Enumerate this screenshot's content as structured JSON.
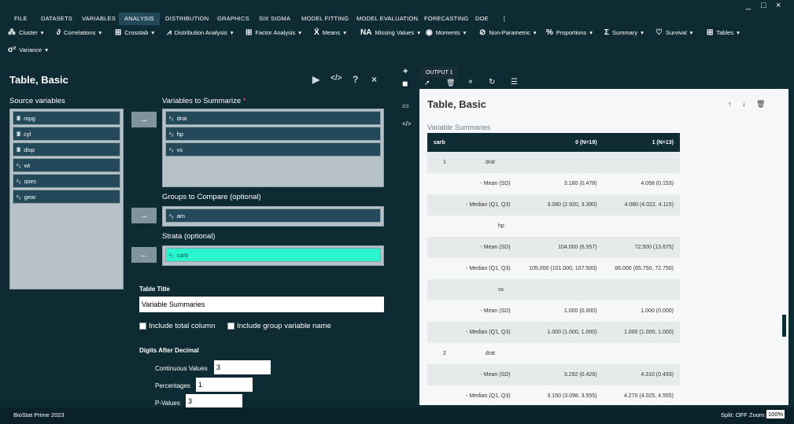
{
  "app": {
    "name": "BioStat Prime 2023"
  },
  "window_controls": [
    "_",
    "□",
    "×"
  ],
  "menu": [
    "FILE",
    "DATASETS",
    "VARIABLES",
    "ANALYSIS",
    "DISTRIBUTION",
    "GRAPHICS",
    "SIX SIGMA",
    "MODEL FITTING",
    "MODEL EVALUATION",
    "FORECASTING",
    "DOE",
    "⋮"
  ],
  "toolbar": [
    {
      "label": "Cluster",
      "icon": "cluster-icon"
    },
    {
      "label": "Correlations",
      "icon": "correlations-icon"
    },
    {
      "label": "Crosstab",
      "icon": "crosstab-icon"
    },
    {
      "label": "Distribution Analysis",
      "icon": "distribution-icon"
    },
    {
      "label": "Factor Analysis",
      "icon": "factor-icon"
    },
    {
      "label": "Means",
      "icon": "means-icon"
    },
    {
      "label": "Missing Values",
      "icon": "missing-icon"
    },
    {
      "label": "Moments",
      "icon": "moments-icon"
    },
    {
      "label": "Non-Parametric",
      "icon": "nonparametric-icon"
    },
    {
      "label": "Proportions",
      "icon": "proportions-icon"
    },
    {
      "label": "Summary",
      "icon": "summary-icon"
    },
    {
      "label": "Survival",
      "icon": "survival-icon"
    },
    {
      "label": "Tables",
      "icon": "tables-icon"
    },
    {
      "label": "Variance",
      "icon": "variance-icon"
    }
  ],
  "left": {
    "title": "Table, Basic",
    "source_label": "Source variables",
    "source_vars": [
      {
        "name": "mpg",
        "type": "numeric"
      },
      {
        "name": "cyl",
        "type": "numeric"
      },
      {
        "name": "disp",
        "type": "numeric"
      },
      {
        "name": "wt",
        "type": "factor"
      },
      {
        "name": "qsec",
        "type": "factor"
      },
      {
        "name": "gear",
        "type": "factor"
      }
    ],
    "summarize_label": "Variables to Summarize",
    "summarize_required": "*",
    "summarize_vars": [
      "drat",
      "hp",
      "vs"
    ],
    "groups_label": "Groups to Compare (optional)",
    "groups_vars": [
      "am"
    ],
    "strata_label": "Strata (optional)",
    "strata_vars": [
      "carb"
    ],
    "table_title_label": "Table Title",
    "table_title_value": "Variable Summaries",
    "include_total_label": "Include total column",
    "include_group_label": "Include group variable name",
    "digits_label": "Digits After Decimal",
    "continuous_label": "Continuous Values",
    "continuous_value": "3",
    "percentages_label": "Percentages",
    "percentages_value": "1",
    "pvalues_label": "P-Values",
    "pvalues_value": "3"
  },
  "right": {
    "tab": "OUTPUT 1",
    "doc_title": "Table, Basic",
    "doc_subtitle": "Variable Summaries",
    "table_headers": [
      "carb",
      "0 (N=19)",
      "1 (N=13)"
    ],
    "table_rows": [
      [
        "1",
        "drat",
        ""
      ],
      [
        "- Mean (SD)",
        "3.180 (0.478)",
        "4.058 (0.153)"
      ],
      [
        "- Median (Q1, Q3)",
        "3.080 (2.920, 3.390)",
        "4.080 (4.022, 4.115)"
      ],
      [
        "",
        "hp",
        ""
      ],
      [
        "- Mean (SD)",
        "104.000 (6.557)",
        "72.500 (13.675)"
      ],
      [
        "- Median (Q1, Q3)",
        "105.000 (101.000, 107.500)",
        "66.000 (65.750, 72.750)"
      ],
      [
        "",
        "vs",
        ""
      ],
      [
        "- Mean (SD)",
        "1.000 (0.000)",
        "1.000 (0.000)"
      ],
      [
        "- Median (Q1, Q3)",
        "1.000 (1.000, 1.000)",
        "1.000 (1.000, 1.000)"
      ],
      [
        "2",
        "drat",
        ""
      ],
      [
        "- Mean (SD)",
        "3.292 (0.429)",
        "4.310 (0.493)"
      ],
      [
        "- Median (Q1, Q3)",
        "3.150 (3.098, 3.555)",
        "4.270 (4.025, 4.555)"
      ]
    ]
  },
  "status": {
    "split": "Split: OFF",
    "zoom_label": "Zoom:",
    "zoom_value": "100%"
  }
}
